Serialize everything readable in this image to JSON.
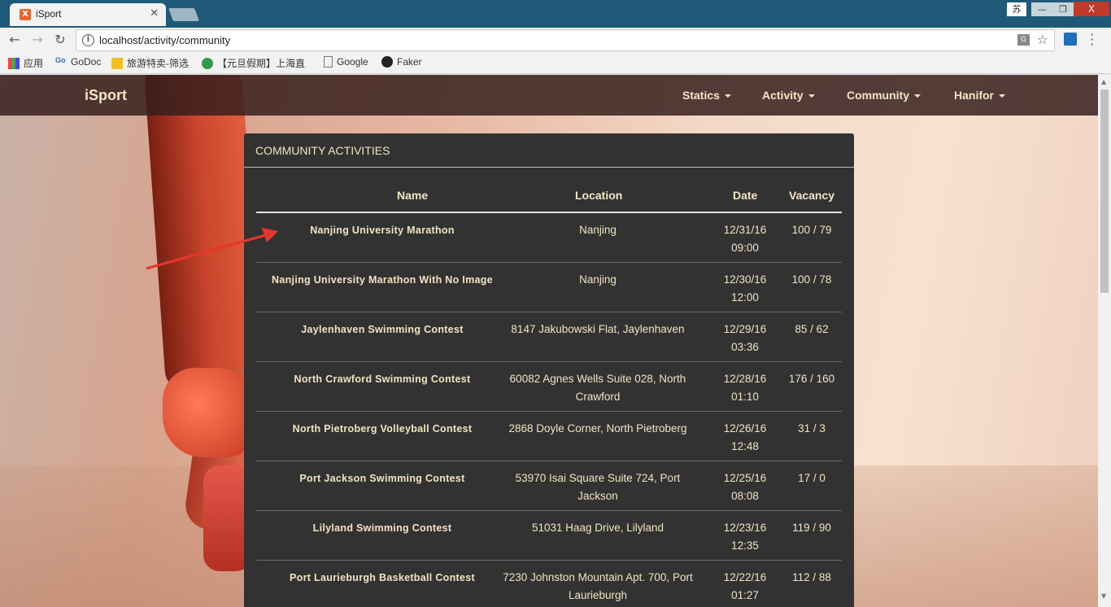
{
  "browser": {
    "tab_title": "iSport",
    "tab_favicon": "X",
    "url": "localhost/activity/community",
    "ime": "苏",
    "minimize": "—",
    "restore": "❐",
    "close": "X",
    "bookmarks": [
      {
        "label": "应用",
        "icon": "apps-grid-icon"
      },
      {
        "label": "GoDoc",
        "icon": "godoc-icon"
      },
      {
        "label": "旅游特卖-筛选",
        "icon": "travel-icon"
      },
      {
        "label": "【元旦假期】上海直",
        "icon": "green-q-icon"
      },
      {
        "label": "Google",
        "icon": "page-icon"
      },
      {
        "label": "Faker",
        "icon": "github-icon"
      }
    ]
  },
  "navbar": {
    "brand": "iSport",
    "items": [
      "Statics",
      "Activity",
      "Community",
      "Hanifor"
    ]
  },
  "panel": {
    "title": "COMMUNITY ACTIVITIES",
    "columns": [
      "Name",
      "Location",
      "Date",
      "Vacancy"
    ]
  },
  "rows": [
    {
      "name": "Nanjing University Marathon",
      "location": "Nanjing",
      "date": "12/31/16 09:00",
      "vacancy": "100 / 79"
    },
    {
      "name": "Nanjing University Marathon With No Image",
      "location": "Nanjing",
      "date": "12/30/16 12:00",
      "vacancy": "100 / 78"
    },
    {
      "name": "Jaylenhaven Swimming Contest",
      "location": "8147 Jakubowski Flat, Jaylenhaven",
      "date": "12/29/16 03:36",
      "vacancy": "85 / 62"
    },
    {
      "name": "North Crawford Swimming Contest",
      "location": "60082 Agnes Wells Suite 028, North Crawford",
      "date": "12/28/16 01:10",
      "vacancy": "176 / 160"
    },
    {
      "name": "North Pietroberg Volleyball Contest",
      "location": "2868 Doyle Corner, North Pietroberg",
      "date": "12/26/16 12:48",
      "vacancy": "31 / 3"
    },
    {
      "name": "Port Jackson Swimming Contest",
      "location": "53970 Isai Square Suite 724, Port Jackson",
      "date": "12/25/16 08:08",
      "vacancy": "17 / 0"
    },
    {
      "name": "Lilyland Swimming Contest",
      "location": "51031 Haag Drive, Lilyland",
      "date": "12/23/16 12:35",
      "vacancy": "119 / 90"
    },
    {
      "name": "Port Laurieburgh Basketball Contest",
      "location": "7230 Johnston Mountain Apt. 700, Port Laurieburgh",
      "date": "12/22/16 01:27",
      "vacancy": "112 / 88"
    }
  ]
}
